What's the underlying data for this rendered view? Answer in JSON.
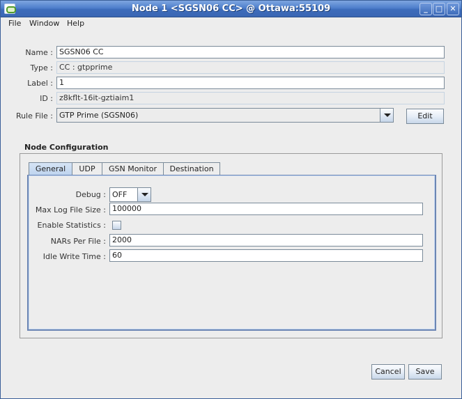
{
  "window": {
    "title": "Node 1 <SGSN06 CC> @ Ottawa:55109",
    "controls": {
      "minimize": "_",
      "maximize": "□",
      "close": "✕"
    }
  },
  "menu": [
    "File",
    "Window",
    "Help"
  ],
  "form": {
    "name_label": "Name :",
    "name_value": "SGSN06 CC",
    "type_label": "Type :",
    "type_value": "CC : gtpprime",
    "label_label": "Label :",
    "label_value": "1",
    "id_label": "ID :",
    "id_value": "z8kflt-16it-gztiaim1",
    "rule_file_label": "Rule File :",
    "rule_file_value": "GTP Prime (SGSN06)",
    "edit_button": "Edit"
  },
  "node_config": {
    "title": "Node Configuration",
    "tabs": [
      "General",
      "UDP",
      "GSN Monitor",
      "Destination"
    ],
    "active_tab": "General",
    "general": {
      "debug_label": "Debug :",
      "debug_value": "OFF",
      "max_log_label": "Max Log File Size :",
      "max_log_value": "100000",
      "enable_stats_label": "Enable Statistics :",
      "enable_stats_checked": false,
      "nars_label": "NARs Per File :",
      "nars_value": "2000",
      "idle_label": "Idle Write Time :",
      "idle_value": "60"
    }
  },
  "footer": {
    "cancel": "Cancel",
    "save": "Save"
  }
}
